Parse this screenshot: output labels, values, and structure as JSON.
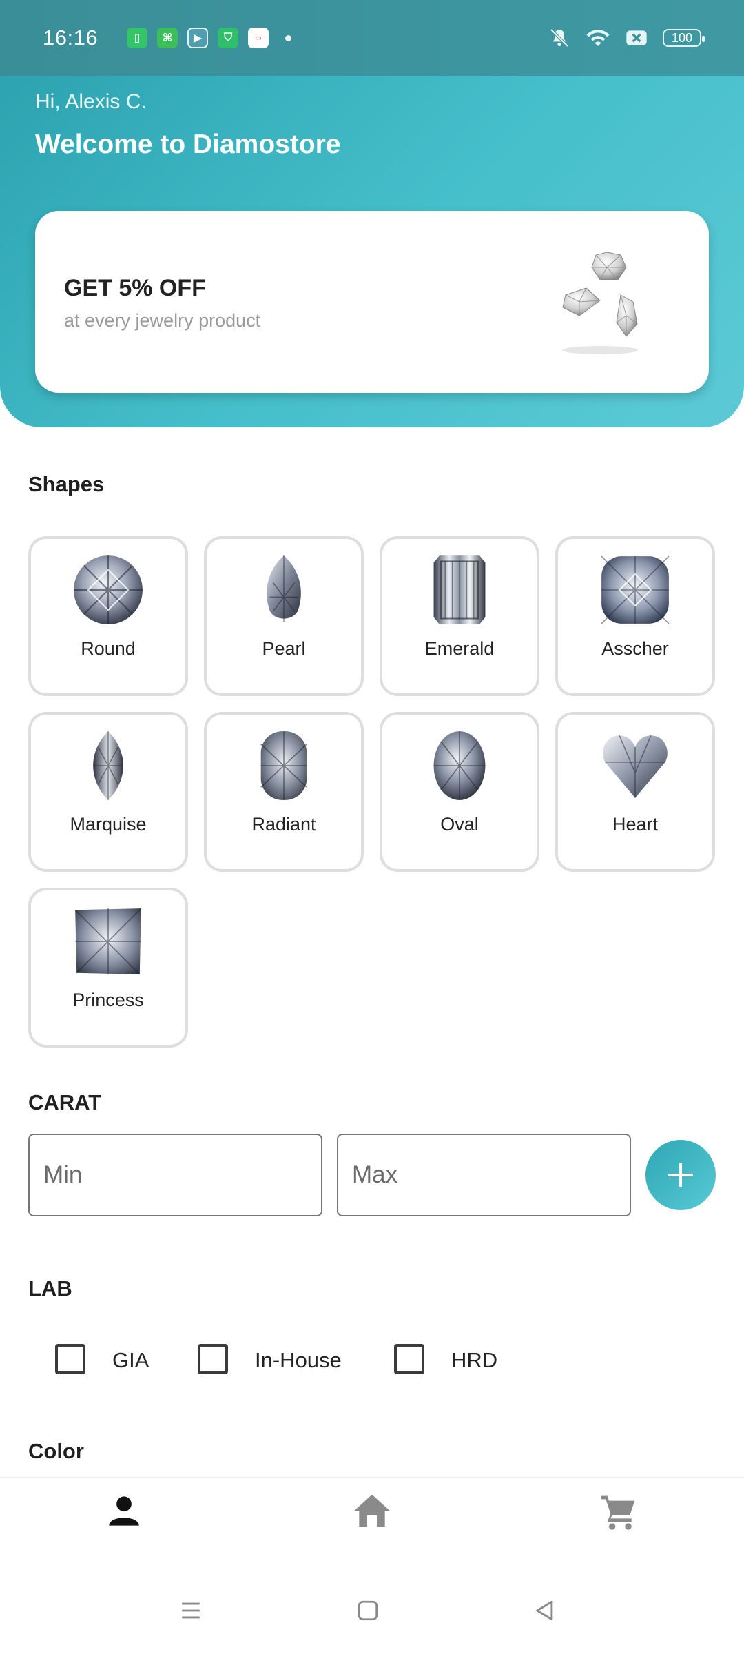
{
  "status_bar": {
    "time": "16:16",
    "battery": "100",
    "notification_icons": [
      "sim-manager-icon",
      "app-icon",
      "youtube-icon",
      "shield-icon",
      "app-tile-icon"
    ],
    "system_icons": [
      "mute-icon",
      "wifi-icon",
      "sim-off-icon",
      "battery-icon"
    ]
  },
  "header": {
    "greeting": "Hi, Alexis C.",
    "welcome": "Welcome to Diamostore",
    "accent_color": "#45bfcb"
  },
  "promo": {
    "title": "GET 5% OFF",
    "subtitle": "at every jewelry product",
    "image": "diamonds-image"
  },
  "shapes": {
    "title": "Shapes",
    "items": [
      {
        "label": "Round",
        "icon": "round-diamond-icon"
      },
      {
        "label": "Pearl",
        "icon": "pear-diamond-icon"
      },
      {
        "label": "Emerald",
        "icon": "emerald-diamond-icon"
      },
      {
        "label": "Asscher",
        "icon": "asscher-diamond-icon"
      },
      {
        "label": "Marquise",
        "icon": "marquise-diamond-icon"
      },
      {
        "label": "Radiant",
        "icon": "radiant-diamond-icon"
      },
      {
        "label": "Oval",
        "icon": "oval-diamond-icon"
      },
      {
        "label": "Heart",
        "icon": "heart-diamond-icon"
      },
      {
        "label": "Princess",
        "icon": "princess-diamond-icon"
      }
    ]
  },
  "carat": {
    "title": "CARAT",
    "min_placeholder": "Min",
    "max_placeholder": "Max",
    "add_label": "+"
  },
  "lab": {
    "title": "LAB",
    "options": [
      {
        "label": "GIA",
        "checked": false
      },
      {
        "label": "In-House",
        "checked": false
      },
      {
        "label": "HRD",
        "checked": false
      }
    ]
  },
  "color": {
    "title": "Color"
  },
  "bottom_nav": {
    "items": [
      {
        "icon": "person-icon",
        "active": true
      },
      {
        "icon": "home-icon",
        "active": false
      },
      {
        "icon": "cart-icon",
        "active": false
      }
    ]
  },
  "system_nav": [
    "menu-icon",
    "home-square-icon",
    "back-triangle-icon"
  ]
}
